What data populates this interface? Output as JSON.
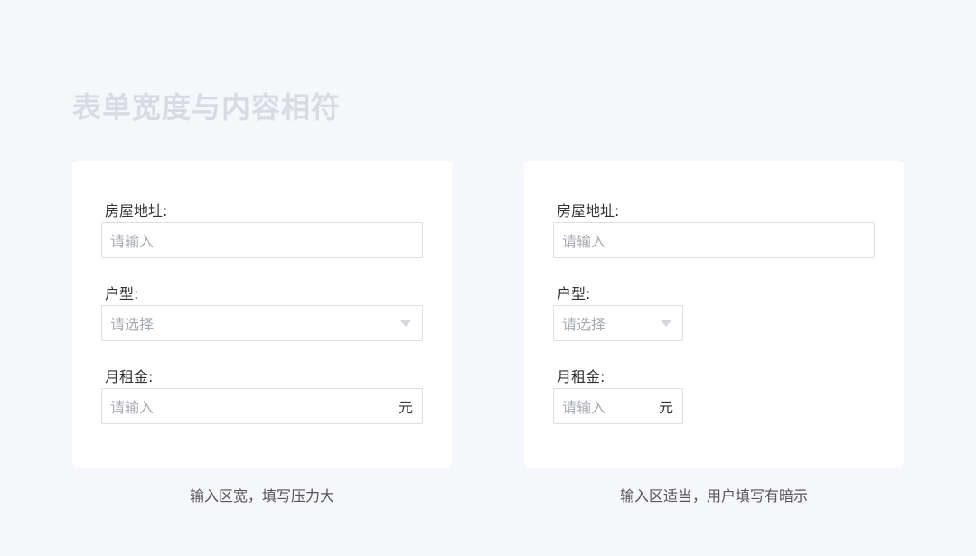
{
  "page": {
    "title": "表单宽度与内容相符"
  },
  "left_form": {
    "address": {
      "label": "房屋地址:",
      "placeholder": "请输入"
    },
    "house_type": {
      "label": "户型:",
      "placeholder": "请选择"
    },
    "monthly_rent": {
      "label": "月租金:",
      "placeholder": "请输入",
      "unit": "元"
    },
    "caption": "输入区宽，填写压力大"
  },
  "right_form": {
    "address": {
      "label": "房屋地址:",
      "placeholder": "请输入"
    },
    "house_type": {
      "label": "户型:",
      "placeholder": "请选择"
    },
    "monthly_rent": {
      "label": "月租金:",
      "placeholder": "请输入",
      "unit": "元"
    },
    "caption": "输入区适当，用户填写有暗示"
  },
  "icons": {
    "dropdown": "caret-down-icon"
  },
  "colors": {
    "background": "#f6f7fb",
    "card": "#ffffff",
    "border": "#dcdfe6",
    "placeholder": "#a8abb2",
    "title": "#d9dbe2"
  }
}
